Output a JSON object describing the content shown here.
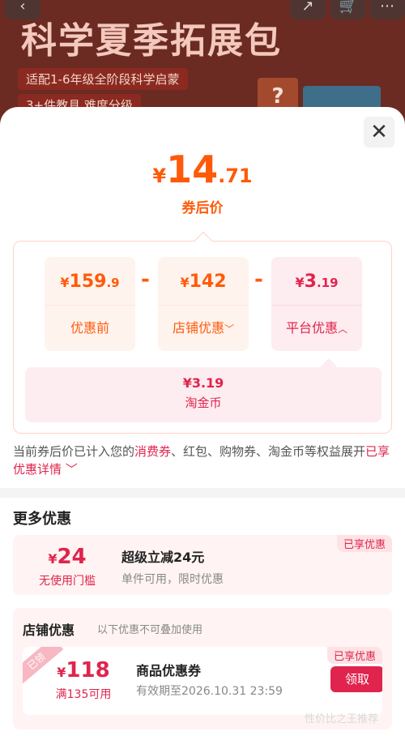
{
  "banner": {
    "title": "科学夏季拓展包",
    "line1": "适配1-6年级全阶段科学启蒙",
    "line2": "3+件教具 难度分级",
    "icons": [
      "back-icon",
      "share-icon",
      "cart-icon",
      "more-icon"
    ]
  },
  "sheet": {
    "close_label": "✕",
    "price": {
      "symbol": "¥",
      "integer": "14",
      "decimal": ".71",
      "label": "券后价"
    },
    "breakdown": {
      "items": [
        {
          "symbol": "¥",
          "integer": "159",
          "decimal": ".9",
          "label": "优惠前"
        },
        {
          "symbol": "¥",
          "integer": "142",
          "decimal": "",
          "label": "店铺优惠"
        },
        {
          "symbol": "¥",
          "integer": "3",
          "decimal": ".19",
          "label": "平台优惠"
        }
      ],
      "operator": "-",
      "coin": {
        "amount": "¥3.19",
        "label": "淘金币"
      }
    },
    "note": {
      "text1": "当前券后价已计入您的",
      "highlight1": "消费券",
      "text2": "、红包、购物券、淘金币等权益展开",
      "link": "已享优惠详情"
    },
    "more": {
      "title": "更多优惠",
      "offer": {
        "tag": "已享优惠",
        "symbol": "¥",
        "amount": "24",
        "condition": "无使用门槛",
        "title": "超级立减24元",
        "subtitle": "单件可用，限时优惠"
      },
      "store": {
        "title": "店铺优惠",
        "subtitle": "以下优惠不可叠加使用",
        "coupon": {
          "ribbon": "已领",
          "tag": "已享优惠",
          "symbol": "¥",
          "amount": "118",
          "condition": "满135可用",
          "title": "商品优惠券",
          "validity": "有效期至2026.10.31 23:59",
          "button": "领取"
        }
      }
    },
    "watermark": "性价比之王推荐"
  }
}
